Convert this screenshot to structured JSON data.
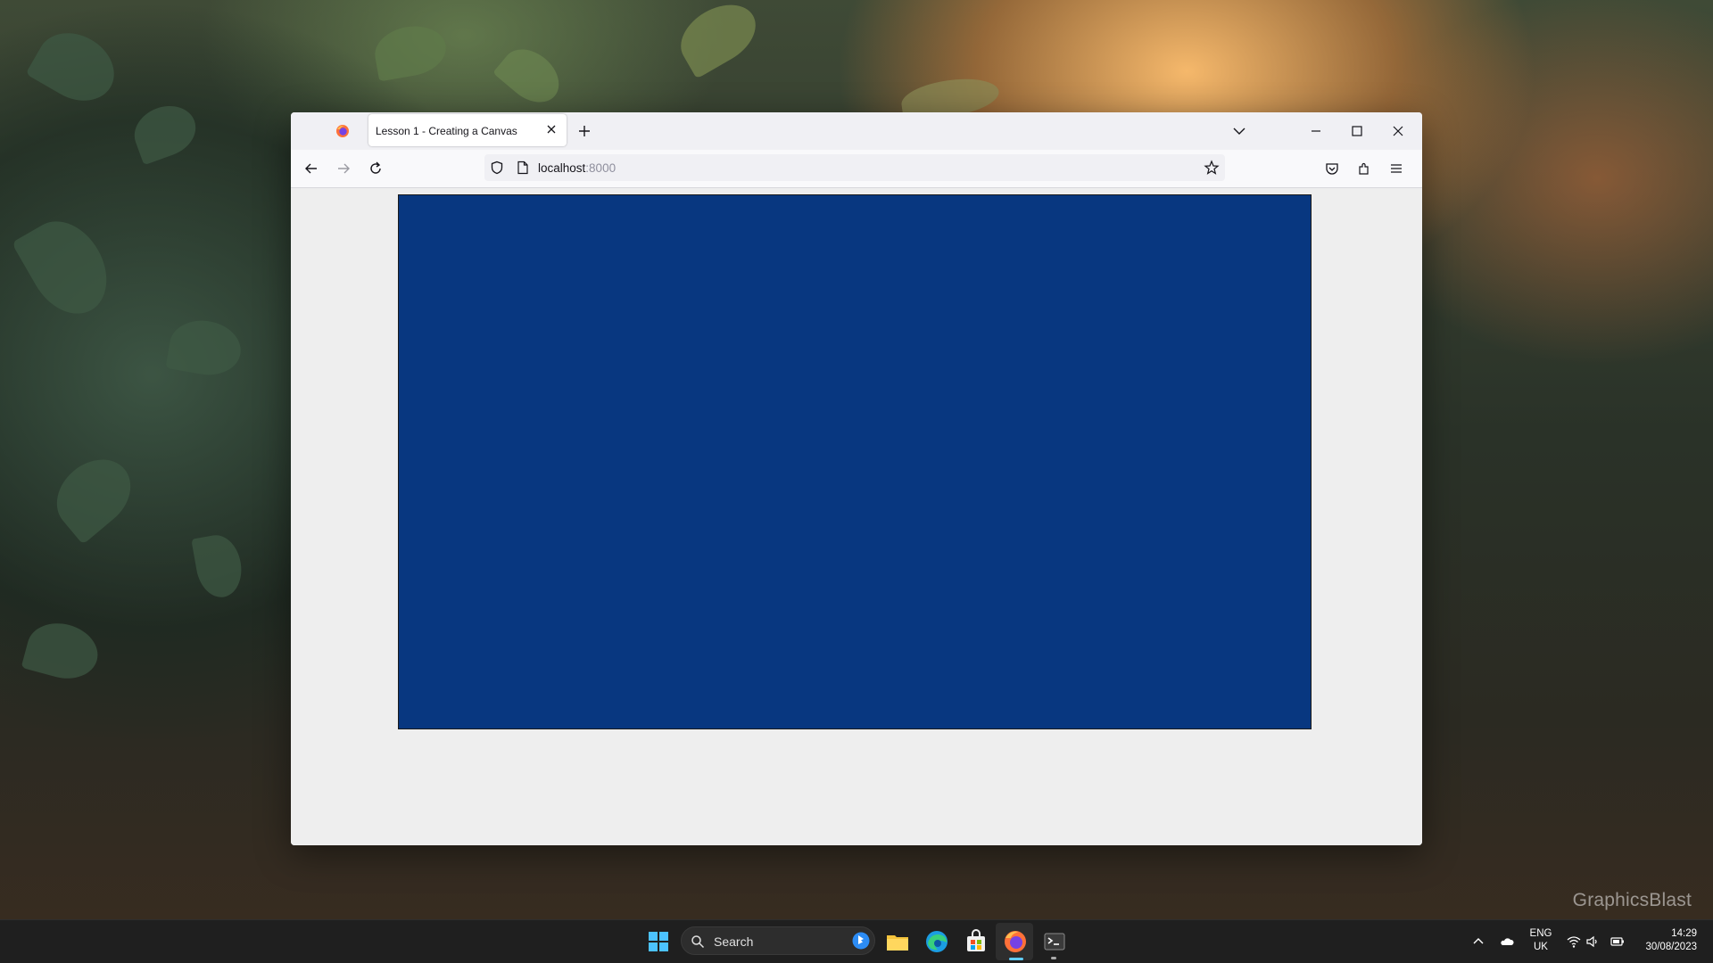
{
  "browser": {
    "tab_title": "Lesson 1 - Creating a Canvas",
    "url_host": "localhost",
    "url_port": ":8000"
  },
  "canvas": {
    "color": "#083780"
  },
  "taskbar": {
    "search_label": "Search",
    "language_line1": "ENG",
    "language_line2": "UK",
    "time": "14:29",
    "date": "30/08/2023"
  },
  "watermark": "GraphicsBlast"
}
